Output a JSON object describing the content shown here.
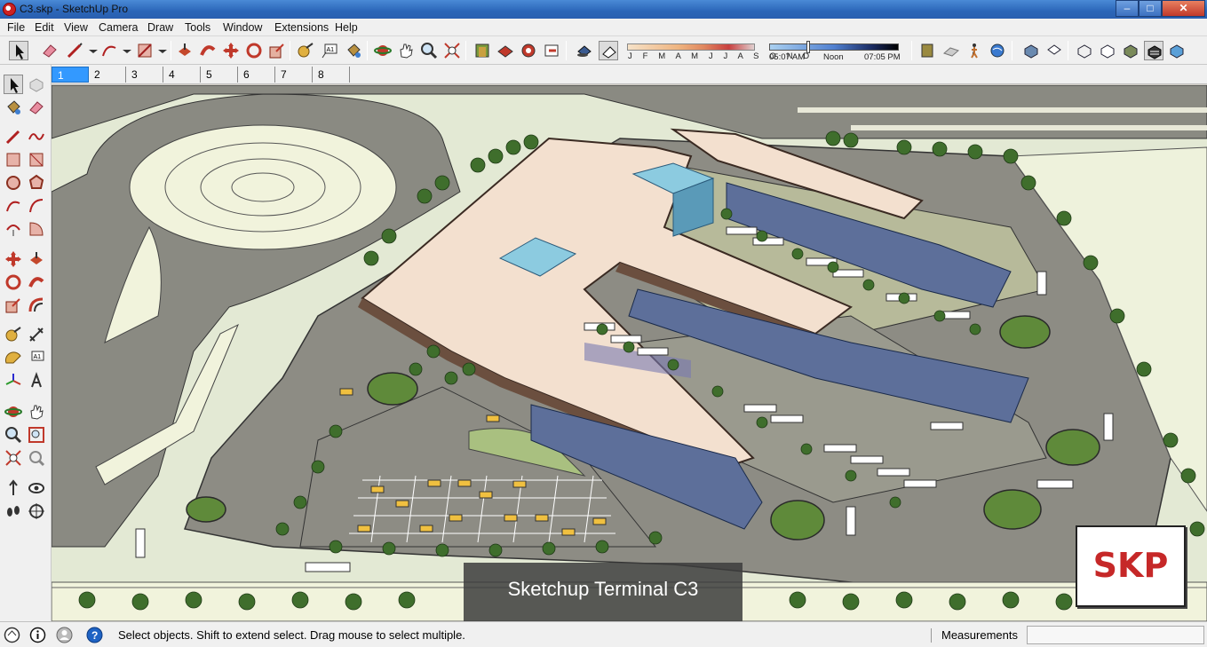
{
  "window": {
    "title": "C3.skp - SketchUp Pro"
  },
  "menu": [
    "File",
    "Edit",
    "View",
    "Camera",
    "Draw",
    "Tools",
    "Window",
    "Extensions",
    "Help"
  ],
  "shadow_settings": {
    "months": "J F M A M J J A S O N D",
    "time_start": "05:07 AM",
    "time_mid": "Noon",
    "time_end": "07:05 PM"
  },
  "scenes": [
    "1",
    "2",
    "3",
    "4",
    "5",
    "6",
    "7",
    "8"
  ],
  "active_scene": "1",
  "viewport": {
    "caption": "Sketchup Terminal C3",
    "logo_text": "SKP"
  },
  "status": {
    "hint": "Select objects. Shift to extend select. Drag mouse to select multiple.",
    "measurements_label": "Measurements",
    "measurements_value": ""
  },
  "colors": {
    "titlebar": "#2b66b8",
    "active_scene": "#3399ff",
    "terrain": "#e3e9d4",
    "road": "#8a8a82",
    "roof": "#f3e0cf",
    "glass": "#8ccbe0",
    "tree": "#3f6e2c",
    "logo_red": "#c62828"
  }
}
